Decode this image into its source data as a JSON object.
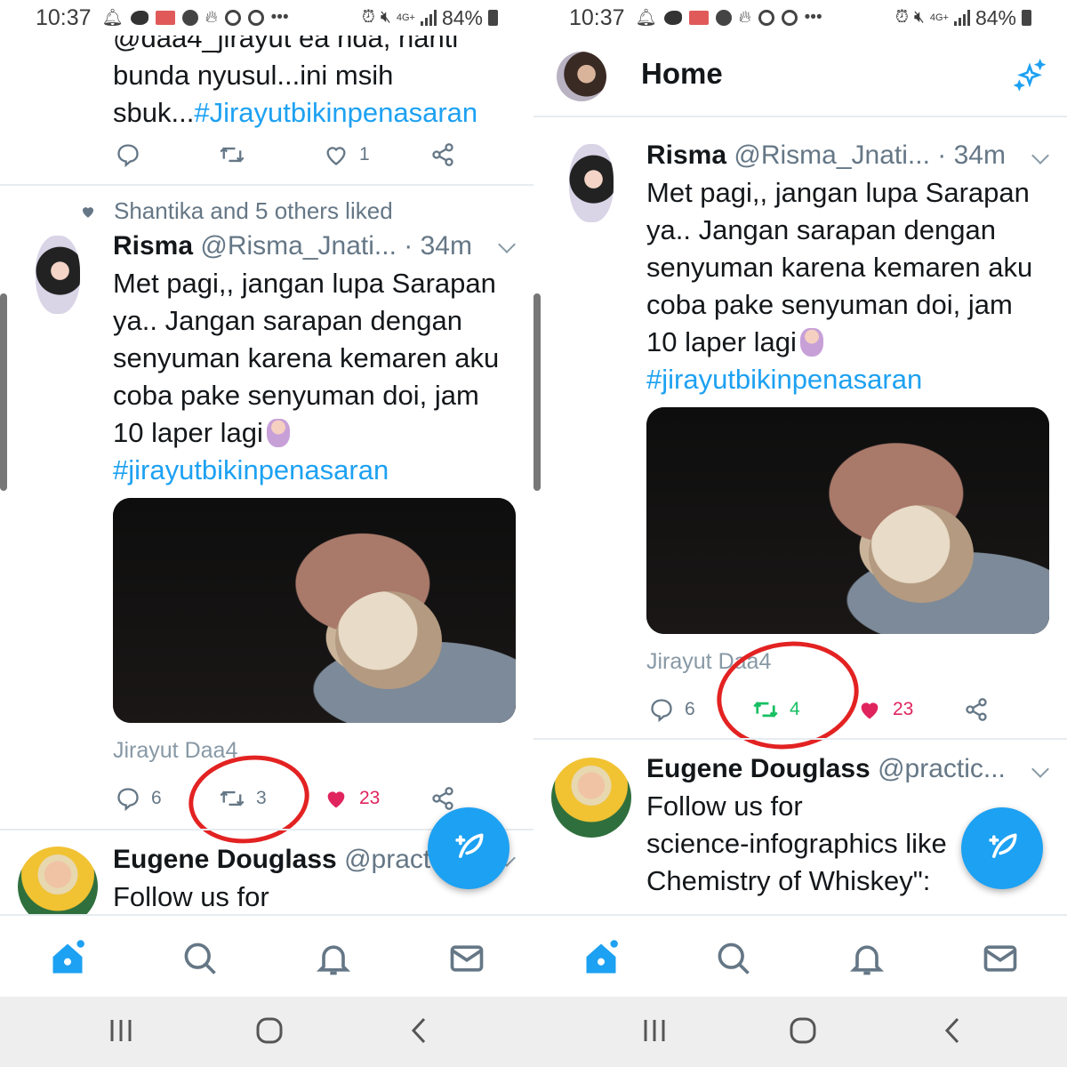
{
  "status_bar": {
    "time": "10:37",
    "network": "4G+",
    "battery": "84%"
  },
  "colors": {
    "twitter_blue": "#1da1f2",
    "retweet_green": "#17bf63",
    "like_pink": "#e0245e",
    "annotation_red": "#e32222",
    "muted_gray": "#657786"
  },
  "left": {
    "prev_tweet": {
      "text_partial_top": "@daa4_jirayut ea nda, nanti",
      "text_line2": "bunda nyusul...ini msih",
      "text_line3_prefix": "sbuk...",
      "hashtag": "#Jirayutbikinpenasaran",
      "like_count": "1"
    },
    "social_context": "Shantika and 5 others liked",
    "tweet": {
      "name": "Risma",
      "handle": "@Risma_Jnati...",
      "time": "· 34m",
      "text_lines": [
        "Met pagi,, jangan lupa Sarapan",
        "ya.. Jangan sarapan dengan",
        "senyuman karena kemaren aku",
        "coba pake senyuman doi, jam",
        "10 laper lagi"
      ],
      "hashtag": "#jirayutbikinpenasaran",
      "media_caption": "Jirayut Daa4",
      "reply_count": "6",
      "retweet_count": "3",
      "like_count": "23"
    },
    "next_tweet": {
      "name": "Eugene Douglass",
      "handle": "@pract",
      "text": "Follow us for"
    }
  },
  "right": {
    "header": {
      "title": "Home"
    },
    "tweet": {
      "name": "Risma",
      "handle": "@Risma_Jnati...",
      "time": "· 34m",
      "text_lines": [
        "Met pagi,, jangan lupa Sarapan",
        "ya.. Jangan sarapan dengan",
        "senyuman karena kemaren aku",
        "coba pake senyuman doi, jam",
        "10 laper lagi"
      ],
      "hashtag": "#jirayutbikinpenasaran",
      "media_caption": "Jirayut Daa4",
      "reply_count": "6",
      "retweet_count": "4",
      "like_count": "23"
    },
    "next_tweet": {
      "name": "Eugene Douglass",
      "handle": "@practic...",
      "text_lines": [
        "Follow us for",
        "science-infographics like",
        "Chemistry of Whiskey\":"
      ]
    }
  },
  "icons": {
    "nav": [
      "home-icon",
      "search-icon",
      "bell-icon",
      "mail-icon"
    ],
    "actions": [
      "reply-icon",
      "retweet-icon",
      "heart-icon",
      "share-icon"
    ]
  }
}
